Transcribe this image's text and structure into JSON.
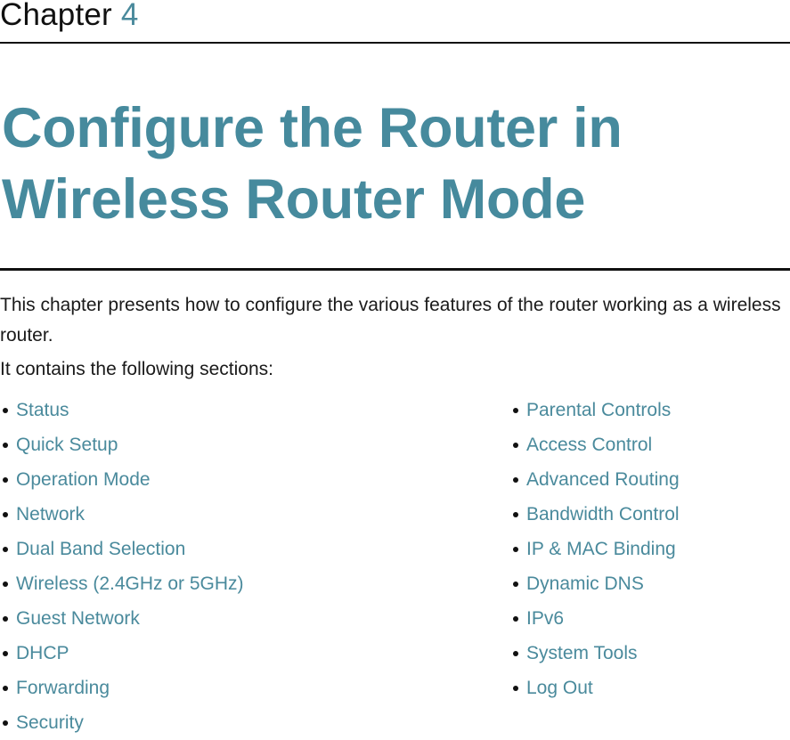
{
  "chapter": {
    "label": "Chapter",
    "number": "4"
  },
  "title": "Configure the Router in Wireless Router Mode",
  "intro": "This chapter presents how to configure the various features of the router working as a wireless router.",
  "contains_label": "It contains the following sections:",
  "colors": {
    "accent": "#468a9d",
    "text": "#1a1a1a"
  },
  "sections_left": [
    {
      "label": "Status"
    },
    {
      "label": "Quick Setup"
    },
    {
      "label": "Operation Mode"
    },
    {
      "label": "Network"
    },
    {
      "label": "Dual Band Selection"
    },
    {
      "label": "Wireless (2.4GHz or 5GHz)"
    },
    {
      "label": "Guest Network"
    },
    {
      "label": "DHCP"
    },
    {
      "label": "Forwarding"
    },
    {
      "label": "Security"
    }
  ],
  "sections_right": [
    {
      "label": "Parental Controls"
    },
    {
      "label": "Access Control"
    },
    {
      "label": "Advanced Routing"
    },
    {
      "label": "Bandwidth Control"
    },
    {
      "label": "IP & MAC Binding"
    },
    {
      "label": "Dynamic DNS"
    },
    {
      "label": "IPv6"
    },
    {
      "label": "System Tools"
    },
    {
      "label": "Log Out"
    }
  ]
}
